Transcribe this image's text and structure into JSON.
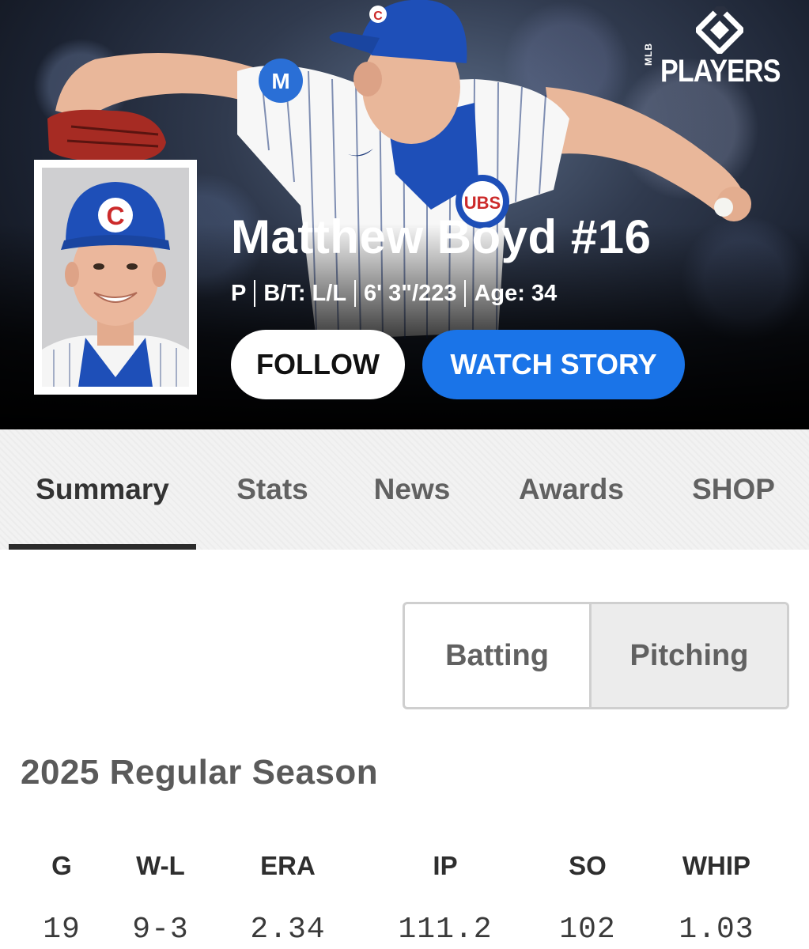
{
  "brand": {
    "logo_text": "PLAYERS",
    "logo_sub": "MLB"
  },
  "player": {
    "name": "Matthew Boyd #16",
    "position": "P",
    "bats_throws": "B/T: L/L",
    "height_weight": "6' 3\"/223",
    "age": "Age: 34",
    "cap_letter": "C",
    "jersey_patch": "UBS"
  },
  "actions": {
    "follow_label": "FOLLOW",
    "watch_label": "WATCH STORY"
  },
  "tabs": [
    {
      "label": "Summary",
      "active": true
    },
    {
      "label": "Stats",
      "active": false
    },
    {
      "label": "News",
      "active": false
    },
    {
      "label": "Awards",
      "active": false
    },
    {
      "label": "SHOP",
      "active": false
    }
  ],
  "stat_toggle": {
    "batting": "Batting",
    "pitching": "Pitching",
    "selected": "Pitching"
  },
  "season": {
    "title": "2025 Regular Season",
    "columns": [
      {
        "header": "G",
        "value": "19"
      },
      {
        "header": "W-L",
        "value": "9-3"
      },
      {
        "header": "ERA",
        "value": "2.34"
      },
      {
        "header": "IP",
        "value": "111.2"
      },
      {
        "header": "SO",
        "value": "102"
      },
      {
        "header": "WHIP",
        "value": "1.03"
      }
    ]
  },
  "colors": {
    "accent_blue": "#1a74e8",
    "cubs_blue": "#1e4fb8",
    "cubs_red": "#cc2a2a"
  }
}
